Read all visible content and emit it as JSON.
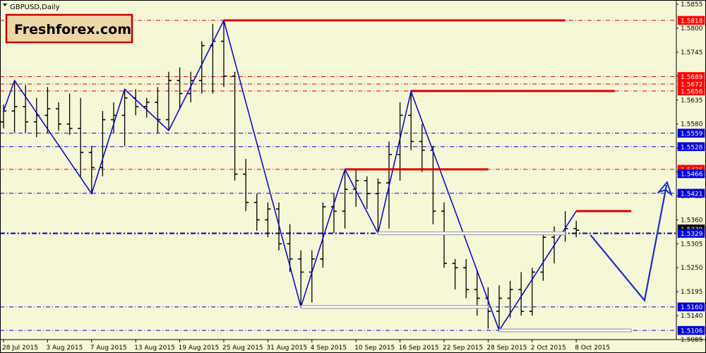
{
  "chart_data": {
    "type": "ohlc",
    "title": "GBPUSD,Daily",
    "brand": "Freshforex.com",
    "colors": {
      "background": "#f6f7d6",
      "bars": "#000000",
      "zigzag": "#0000cc",
      "resistance": "#dd0000",
      "support_label": "#0000dd",
      "support_band": "#c8c8c8",
      "forecast": "#1a2ccc"
    },
    "ylim": [
      1.5085,
      1.586
    ],
    "y_ticks": [
      1.5855,
      1.58,
      1.5745,
      1.569,
      1.5635,
      1.558,
      1.5525,
      1.547,
      1.5415,
      1.536,
      1.5305,
      1.525,
      1.5195,
      1.514,
      1.5085
    ],
    "x_labels": [
      {
        "i": 0,
        "label": "28 Jul 2015"
      },
      {
        "i": 4,
        "label": "3 Aug 2015"
      },
      {
        "i": 8,
        "label": "7 Aug 2015"
      },
      {
        "i": 12,
        "label": "13 Aug 2015"
      },
      {
        "i": 16,
        "label": "19 Aug 2015"
      },
      {
        "i": 20,
        "label": "25 Aug 2015"
      },
      {
        "i": 24,
        "label": "31 Aug 2015"
      },
      {
        "i": 28,
        "label": "4 Sep 2015"
      },
      {
        "i": 32,
        "label": "10 Sep 2015"
      },
      {
        "i": 36,
        "label": "16 Sep 2015"
      },
      {
        "i": 40,
        "label": "22 Sep 2015"
      },
      {
        "i": 44,
        "label": "28 Sep 2015"
      },
      {
        "i": 48,
        "label": "2 Oct 2015"
      },
      {
        "i": 52,
        "label": "8 Oct 2015"
      }
    ],
    "ohlc": [
      {
        "o": 1.5585,
        "h": 1.5625,
        "l": 1.557,
        "c": 1.561
      },
      {
        "o": 1.561,
        "h": 1.568,
        "l": 1.556,
        "c": 1.562
      },
      {
        "o": 1.562,
        "h": 1.567,
        "l": 1.556,
        "c": 1.5585
      },
      {
        "o": 1.5585,
        "h": 1.564,
        "l": 1.555,
        "c": 1.56
      },
      {
        "o": 1.56,
        "h": 1.5665,
        "l": 1.556,
        "c": 1.5615
      },
      {
        "o": 1.5615,
        "h": 1.563,
        "l": 1.5565,
        "c": 1.558
      },
      {
        "o": 1.558,
        "h": 1.565,
        "l": 1.5555,
        "c": 1.557
      },
      {
        "o": 1.557,
        "h": 1.564,
        "l": 1.546,
        "c": 1.5515
      },
      {
        "o": 1.5515,
        "h": 1.553,
        "l": 1.542,
        "c": 1.548
      },
      {
        "o": 1.548,
        "h": 1.561,
        "l": 1.546,
        "c": 1.559
      },
      {
        "o": 1.559,
        "h": 1.563,
        "l": 1.556,
        "c": 1.56
      },
      {
        "o": 1.56,
        "h": 1.566,
        "l": 1.553,
        "c": 1.564
      },
      {
        "o": 1.564,
        "h": 1.566,
        "l": 1.56,
        "c": 1.562
      },
      {
        "o": 1.562,
        "h": 1.564,
        "l": 1.5595,
        "c": 1.563
      },
      {
        "o": 1.563,
        "h": 1.5665,
        "l": 1.556,
        "c": 1.559
      },
      {
        "o": 1.559,
        "h": 1.57,
        "l": 1.5565,
        "c": 1.568
      },
      {
        "o": 1.568,
        "h": 1.571,
        "l": 1.5615,
        "c": 1.565
      },
      {
        "o": 1.565,
        "h": 1.57,
        "l": 1.563,
        "c": 1.568
      },
      {
        "o": 1.568,
        "h": 1.577,
        "l": 1.565,
        "c": 1.576
      },
      {
        "o": 1.576,
        "h": 1.581,
        "l": 1.565,
        "c": 1.577
      },
      {
        "o": 1.577,
        "h": 1.5818,
        "l": 1.5665,
        "c": 1.569
      },
      {
        "o": 1.569,
        "h": 1.57,
        "l": 1.545,
        "c": 1.5465
      },
      {
        "o": 1.5465,
        "h": 1.55,
        "l": 1.538,
        "c": 1.54
      },
      {
        "o": 1.54,
        "h": 1.542,
        "l": 1.5335,
        "c": 1.536
      },
      {
        "o": 1.536,
        "h": 1.54,
        "l": 1.532,
        "c": 1.5385
      },
      {
        "o": 1.5385,
        "h": 1.54,
        "l": 1.529,
        "c": 1.5305
      },
      {
        "o": 1.5305,
        "h": 1.535,
        "l": 1.524,
        "c": 1.527
      },
      {
        "o": 1.527,
        "h": 1.529,
        "l": 1.516,
        "c": 1.524
      },
      {
        "o": 1.524,
        "h": 1.529,
        "l": 1.517,
        "c": 1.527
      },
      {
        "o": 1.527,
        "h": 1.54,
        "l": 1.525,
        "c": 1.539
      },
      {
        "o": 1.539,
        "h": 1.542,
        "l": 1.533,
        "c": 1.538
      },
      {
        "o": 1.538,
        "h": 1.5476,
        "l": 1.534,
        "c": 1.543
      },
      {
        "o": 1.543,
        "h": 1.5475,
        "l": 1.539,
        "c": 1.545
      },
      {
        "o": 1.545,
        "h": 1.546,
        "l": 1.5385,
        "c": 1.542
      },
      {
        "o": 1.542,
        "h": 1.5455,
        "l": 1.5329,
        "c": 1.5445
      },
      {
        "o": 1.5445,
        "h": 1.554,
        "l": 1.534,
        "c": 1.551
      },
      {
        "o": 1.551,
        "h": 1.563,
        "l": 1.545,
        "c": 1.56
      },
      {
        "o": 1.56,
        "h": 1.5655,
        "l": 1.552,
        "c": 1.554
      },
      {
        "o": 1.554,
        "h": 1.558,
        "l": 1.547,
        "c": 1.552
      },
      {
        "o": 1.552,
        "h": 1.553,
        "l": 1.535,
        "c": 1.538
      },
      {
        "o": 1.538,
        "h": 1.54,
        "l": 1.525,
        "c": 1.526
      },
      {
        "o": 1.526,
        "h": 1.527,
        "l": 1.52,
        "c": 1.525
      },
      {
        "o": 1.525,
        "h": 1.527,
        "l": 1.518,
        "c": 1.52
      },
      {
        "o": 1.52,
        "h": 1.5245,
        "l": 1.514,
        "c": 1.518
      },
      {
        "o": 1.518,
        "h": 1.5205,
        "l": 1.511,
        "c": 1.515
      },
      {
        "o": 1.515,
        "h": 1.521,
        "l": 1.5106,
        "c": 1.518
      },
      {
        "o": 1.518,
        "h": 1.522,
        "l": 1.5135,
        "c": 1.52
      },
      {
        "o": 1.52,
        "h": 1.524,
        "l": 1.514,
        "c": 1.515
      },
      {
        "o": 1.515,
        "h": 1.525,
        "l": 1.514,
        "c": 1.524
      },
      {
        "o": 1.524,
        "h": 1.533,
        "l": 1.522,
        "c": 1.532
      },
      {
        "o": 1.532,
        "h": 1.5345,
        "l": 1.526,
        "c": 1.533
      },
      {
        "o": 1.533,
        "h": 1.538,
        "l": 1.531,
        "c": 1.534
      },
      {
        "o": 1.534,
        "h": 1.5358,
        "l": 1.532,
        "c": 1.5336
      }
    ],
    "zigzag": [
      {
        "i": 0,
        "p": 1.561
      },
      {
        "i": 1,
        "p": 1.568
      },
      {
        "i": 8,
        "p": 1.542
      },
      {
        "i": 11,
        "p": 1.566
      },
      {
        "i": 15,
        "p": 1.5565
      },
      {
        "i": 20,
        "p": 1.5818
      },
      {
        "i": 27,
        "p": 1.516
      },
      {
        "i": 31,
        "p": 1.5476
      },
      {
        "i": 34,
        "p": 1.5329
      },
      {
        "i": 37,
        "p": 1.5655
      },
      {
        "i": 45,
        "p": 1.5106
      },
      {
        "i": 52,
        "p": 1.538
      }
    ],
    "resistance_lines": [
      {
        "i": 20,
        "price": 1.5818,
        "to_i": 51
      },
      {
        "i": 37,
        "price": 1.5656,
        "to_i": 55.5
      },
      {
        "i": 31,
        "price": 1.5476,
        "to_i": 44
      },
      {
        "i": 52,
        "price": 1.538,
        "to_i": 57
      }
    ],
    "support_bands": [
      {
        "i": 34,
        "price": 1.5329,
        "to_i": 51
      },
      {
        "i": 27,
        "price": 1.516,
        "to_i": 44
      },
      {
        "i": 45,
        "price": 1.5106,
        "to_i": 57
      }
    ],
    "h_levels_red": [
      1.5818,
      1.5689,
      1.5672,
      1.5656,
      1.5476
    ],
    "h_levels_blue": [
      1.5559,
      1.5528,
      1.5421,
      1.516,
      1.5106
    ],
    "h_levels_blue_thick": [
      1.5329
    ],
    "price_labels": [
      {
        "text": "1.5818",
        "price": 1.5818,
        "kind": "red"
      },
      {
        "text": "1.5689",
        "price": 1.5689,
        "kind": "red"
      },
      {
        "text": "1.5672",
        "price": 1.5672,
        "kind": "red"
      },
      {
        "text": "1.5656",
        "price": 1.5656,
        "kind": "red"
      },
      {
        "text": "1.5559",
        "price": 1.5559,
        "kind": "blue"
      },
      {
        "text": "1.5528",
        "price": 1.5528,
        "kind": "blue"
      },
      {
        "text": "1.5476",
        "price": 1.5476,
        "kind": "red"
      },
      {
        "text": "1.5466",
        "price": 1.5466,
        "kind": "blue"
      },
      {
        "text": "1.5421",
        "price": 1.5421,
        "kind": "blue"
      },
      {
        "text": "1.5339",
        "price": 1.5339,
        "kind": "black"
      },
      {
        "text": "1.5329",
        "price": 1.5329,
        "kind": "blue"
      },
      {
        "text": "1.5160",
        "price": 1.516,
        "kind": "blue"
      },
      {
        "text": "1.5106",
        "price": 1.5106,
        "kind": "blue"
      }
    ],
    "forecast_path": [
      {
        "i": 53.3,
        "p": 1.5325
      },
      {
        "i": 58.2,
        "p": 1.5175
      },
      {
        "i": 60.2,
        "p": 1.544
      }
    ]
  }
}
